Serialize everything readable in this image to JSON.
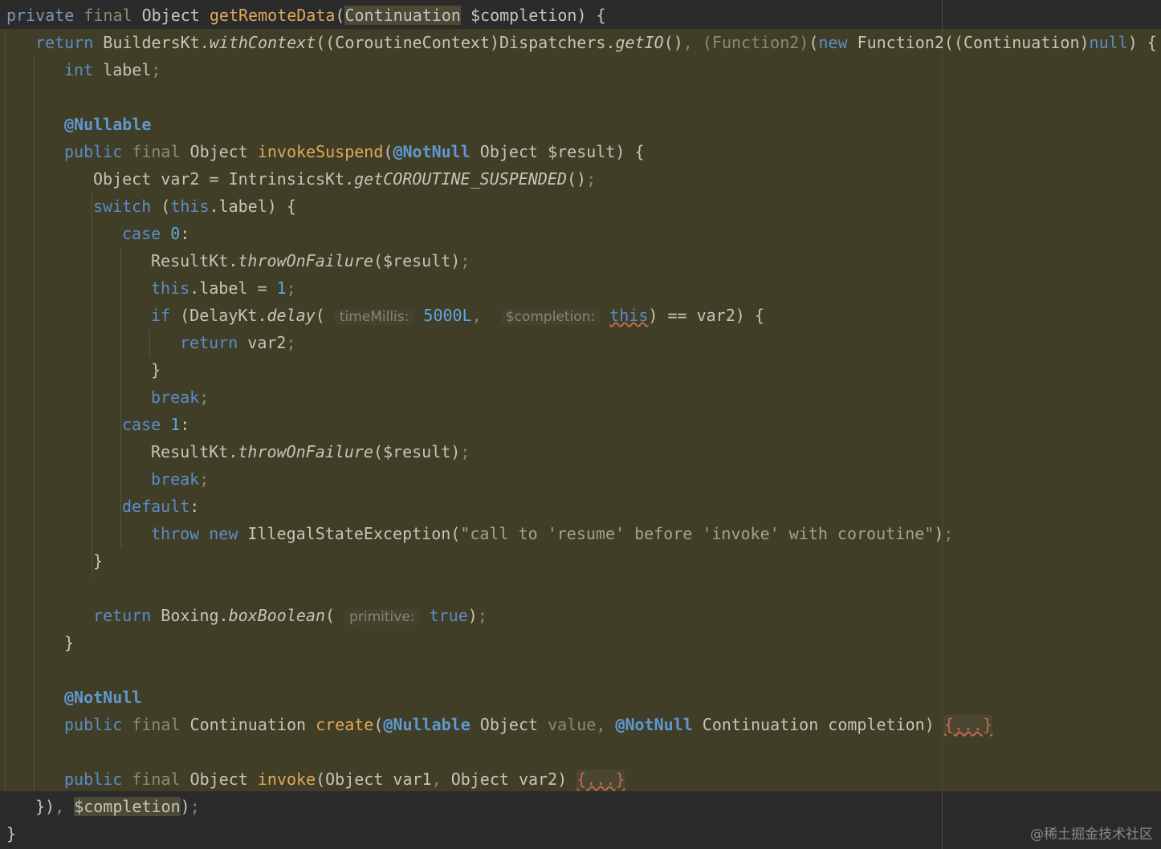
{
  "editor": {
    "lines": [
      {
        "tokens": [
          [
            "kwd",
            "private "
          ],
          [
            "dim",
            "final "
          ],
          [
            "",
            "Object "
          ],
          [
            "fn",
            "getRemoteData"
          ],
          [
            "",
            "("
          ],
          [
            "sel-bg",
            "Continuation"
          ],
          [
            "",
            " $completion) {"
          ]
        ]
      },
      {
        "tokens": [
          [
            "kw2",
            "return "
          ],
          [
            "",
            "BuildersKt."
          ],
          [
            "it",
            "withContext"
          ],
          [
            "",
            "((CoroutineContext)Dispatchers."
          ],
          [
            "it",
            "getIO"
          ],
          [
            "",
            "()"
          ],
          [
            "punct",
            ", "
          ],
          [
            "dim",
            "(Function2)"
          ],
          [
            "",
            "("
          ],
          [
            "kw2",
            "new "
          ],
          [
            "",
            "Function2((Continuation)"
          ],
          [
            "kw2",
            "null"
          ],
          [
            "",
            ") {"
          ]
        ]
      },
      {
        "tokens": [
          [
            "kw2",
            "int "
          ],
          [
            "",
            "label"
          ],
          [
            "punct",
            ";"
          ]
        ]
      },
      {
        "tokens": []
      },
      {
        "tokens": [
          [
            "ann",
            "@Nullable"
          ]
        ]
      },
      {
        "tokens": [
          [
            "kw2",
            "public "
          ],
          [
            "dim",
            "final "
          ],
          [
            "",
            "Object "
          ],
          [
            "fn",
            "invokeSuspend"
          ],
          [
            "",
            "("
          ],
          [
            "ann",
            "@NotNull"
          ],
          [
            "",
            " Object $result) {"
          ]
        ]
      },
      {
        "tokens": [
          [
            "",
            "Object var2 = IntrinsicsKt."
          ],
          [
            "it",
            "getCOROUTINE_SUSPENDED"
          ],
          [
            "",
            "()"
          ],
          [
            "punct",
            ";"
          ]
        ]
      },
      {
        "tokens": [
          [
            "kw2",
            "switch "
          ],
          [
            "",
            "("
          ],
          [
            "kw2",
            "this"
          ],
          [
            "",
            ".label) {"
          ]
        ]
      },
      {
        "tokens": [
          [
            "kw2",
            "case "
          ],
          [
            "num",
            "0"
          ],
          [
            "",
            ":"
          ]
        ]
      },
      {
        "tokens": [
          [
            "",
            "ResultKt."
          ],
          [
            "it",
            "throwOnFailure"
          ],
          [
            "",
            "($result)"
          ],
          [
            "punct",
            ";"
          ]
        ]
      },
      {
        "tokens": [
          [
            "kw2",
            "this"
          ],
          [
            "",
            ".label = "
          ],
          [
            "num",
            "1"
          ],
          [
            "punct",
            ";"
          ]
        ]
      },
      {
        "tokens": [
          [
            "kw2",
            "if "
          ],
          [
            "",
            "(DelayKt."
          ],
          [
            "it",
            "delay"
          ],
          [
            "",
            "( "
          ],
          [
            "hint",
            "timeMillis:"
          ],
          [
            "",
            " "
          ],
          [
            "num",
            "5000L"
          ],
          [
            "punct",
            ", "
          ],
          [
            "",
            " "
          ],
          [
            "hint",
            "$completion:"
          ],
          [
            "",
            " "
          ],
          [
            "kw2 squig",
            "this"
          ],
          [
            "",
            ") == var2) {"
          ]
        ]
      },
      {
        "tokens": [
          [
            "kw2",
            "return "
          ],
          [
            "",
            "var2"
          ],
          [
            "punct",
            ";"
          ]
        ]
      },
      {
        "tokens": [
          [
            "",
            "}"
          ]
        ]
      },
      {
        "tokens": [
          [
            "kw2",
            "break"
          ],
          [
            "punct",
            ";"
          ]
        ]
      },
      {
        "tokens": [
          [
            "kw2",
            "case "
          ],
          [
            "num",
            "1"
          ],
          [
            "",
            ":"
          ]
        ]
      },
      {
        "tokens": [
          [
            "",
            "ResultKt."
          ],
          [
            "it",
            "throwOnFailure"
          ],
          [
            "",
            "($result)"
          ],
          [
            "punct",
            ";"
          ]
        ]
      },
      {
        "tokens": [
          [
            "kw2",
            "break"
          ],
          [
            "punct",
            ";"
          ]
        ]
      },
      {
        "tokens": [
          [
            "kw2",
            "default"
          ],
          [
            "",
            ":"
          ]
        ]
      },
      {
        "tokens": [
          [
            "kw2",
            "throw "
          ],
          [
            "kw2",
            "new "
          ],
          [
            "",
            "IllegalStateException("
          ],
          [
            "str",
            "\"call to 'resume' before 'invoke' with coroutine\""
          ],
          [
            "",
            ")"
          ],
          [
            "punct",
            ";"
          ]
        ]
      },
      {
        "tokens": [
          [
            "",
            "}"
          ]
        ]
      },
      {
        "tokens": []
      },
      {
        "tokens": [
          [
            "kw2",
            "return "
          ],
          [
            "",
            "Boxing."
          ],
          [
            "it",
            "boxBoolean"
          ],
          [
            "",
            "( "
          ],
          [
            "hint",
            "primitive:"
          ],
          [
            "",
            " "
          ],
          [
            "kw2",
            "true"
          ],
          [
            "",
            ")"
          ],
          [
            "punct",
            ";"
          ]
        ]
      },
      {
        "tokens": [
          [
            "",
            "}"
          ]
        ]
      },
      {
        "tokens": []
      },
      {
        "tokens": [
          [
            "ann",
            "@NotNull"
          ]
        ]
      },
      {
        "tokens": [
          [
            "kw2",
            "public "
          ],
          [
            "dim",
            "final "
          ],
          [
            "",
            "Continuation "
          ],
          [
            "fn",
            "create"
          ],
          [
            "",
            "("
          ],
          [
            "ann",
            "@Nullable"
          ],
          [
            "",
            " Object "
          ],
          [
            "dim",
            "value"
          ],
          [
            "punct",
            ", "
          ],
          [
            "ann",
            "@NotNull"
          ],
          [
            "",
            " Continuation completion) "
          ],
          [
            "fold",
            "{...}"
          ]
        ]
      },
      {
        "tokens": []
      },
      {
        "tokens": [
          [
            "kw2",
            "public "
          ],
          [
            "dim",
            "final "
          ],
          [
            "",
            "Object "
          ],
          [
            "fn",
            "invoke"
          ],
          [
            "",
            "(Object var1"
          ],
          [
            "punct",
            ", "
          ],
          [
            "",
            "Object var2) "
          ],
          [
            "fold",
            "{...}"
          ]
        ]
      },
      {
        "tokens": [
          [
            "",
            "})"
          ],
          [
            "punct",
            ", "
          ],
          [
            "sel-bg",
            "$completion"
          ],
          [
            "",
            ")"
          ],
          [
            "punct",
            ";"
          ]
        ]
      },
      {
        "tokens": [
          [
            "",
            "}"
          ]
        ]
      }
    ]
  },
  "watermark": "@稀土掘金技术社区"
}
